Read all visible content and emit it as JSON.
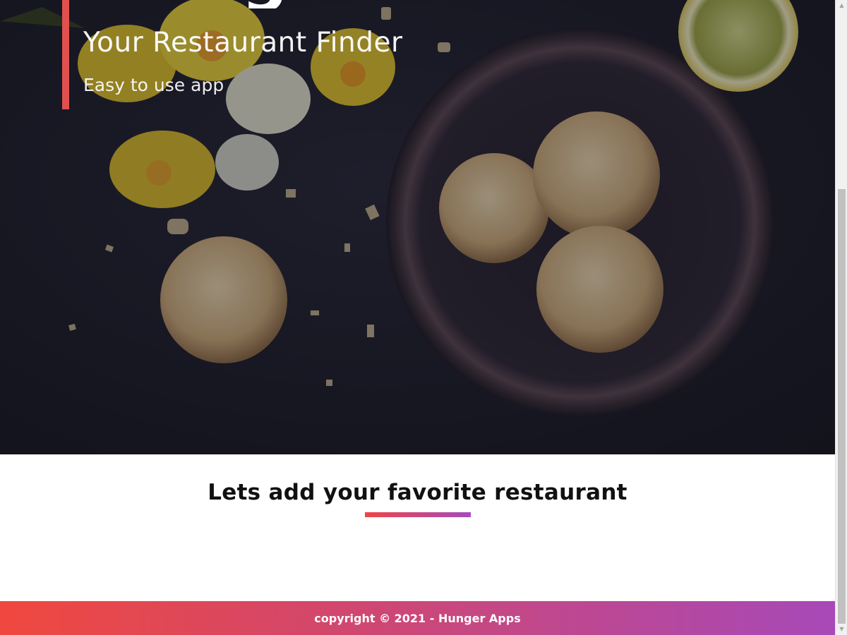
{
  "hero": {
    "brand": "Hunger App",
    "tagline": "Your Restaurant Finder",
    "subtitle": "Easy to use app"
  },
  "favorites": {
    "title": "Lets add your favorite restaurant"
  },
  "footer": {
    "copyright": "copyright © 2021 - Hunger Apps"
  },
  "colors": {
    "accent_red": "#ef4444",
    "accent_purple": "#a54bbd",
    "hero_background": "#1d1d2b"
  },
  "icons": {
    "scroll_up": "triangle-up-icon",
    "scroll_down": "triangle-down-icon"
  }
}
